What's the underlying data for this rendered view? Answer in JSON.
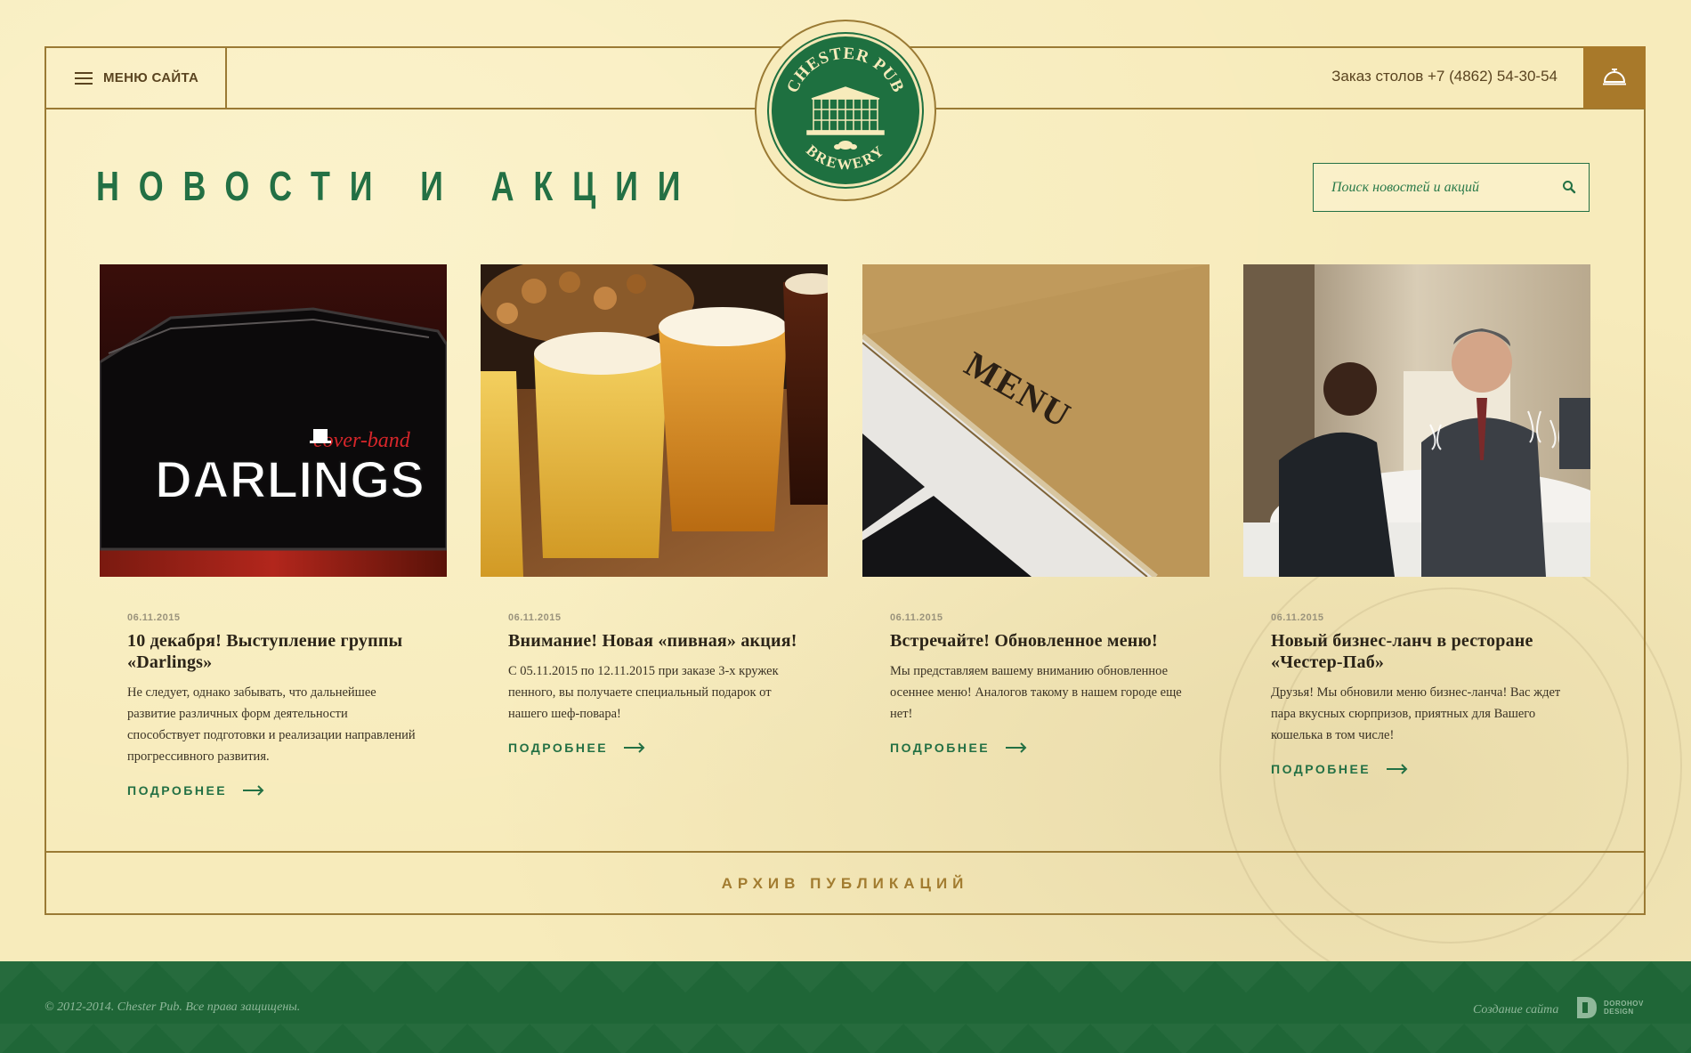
{
  "header": {
    "menu_label": "МЕНЮ САЙТА",
    "phone_text": "Заказ столов +7 (4862) 54-30-54",
    "bell_icon": "service-bell-icon",
    "logo": {
      "top_text": "CHESTER PUB",
      "bottom_text": "BREWERY"
    }
  },
  "main": {
    "title": "НОВОСТИ И АКЦИИ",
    "search": {
      "placeholder": "Поиск новостей и акций",
      "icon": "search-icon"
    },
    "cards": [
      {
        "image_alt": "Darlings cover-band logo",
        "image_text": "DARLINGS",
        "image_subtext": "cover-band",
        "date": "06.11.2015",
        "title": "10 декабря! Выступление группы «Darlings»",
        "description": "Не следует, однако забывать, что дальнейшее развитие различных форм деятельности способствует подготовки и реализации направлений прогрессивного развития.",
        "more_label": "ПОДРОБНЕЕ"
      },
      {
        "image_alt": "Glasses of beer",
        "date": "06.11.2015",
        "title": "Внимание! Новая «пивная» акция!",
        "description": "С 05.11.2015 по 12.11.2015 при заказе 3-х кружек пенного, вы получаете специальный подарок от нашего шеф-повара!",
        "more_label": "ПОДРОБНЕЕ"
      },
      {
        "image_alt": "Burlap menu",
        "image_text": "MENU",
        "date": "06.11.2015",
        "title": "Встречайте! Обновленное меню!",
        "description": "Мы представляем вашему вниманию обновленное осеннее меню! Аналогов такому в нашем городе еще нет!",
        "more_label": "ПОДРОБНЕЕ"
      },
      {
        "image_alt": "Business lunch in restaurant",
        "date": "06.11.2015",
        "title": "Новый бизнес-ланч в ресторане «Честер-Паб»",
        "description": "Друзья! Мы обновили меню бизнес-ланча! Вас ждет пара вкусных сюрпризов, приятных для Вашего кошелька в том числе!",
        "more_label": "ПОДРОБНЕЕ"
      }
    ],
    "archive_label": "АРХИВ ПУБЛИКАЦИЙ"
  },
  "footer": {
    "copyright": "© 2012-2014. Chester Pub. Все права защищены.",
    "made_by": "Создание сайта",
    "studio_line1": "DOROHOV",
    "studio_line2": "DESIGN"
  },
  "colors": {
    "background": "#f7ebbb",
    "accent_green": "#237044",
    "frame_brown": "#9a7a34",
    "footer_green": "#1f6637"
  }
}
